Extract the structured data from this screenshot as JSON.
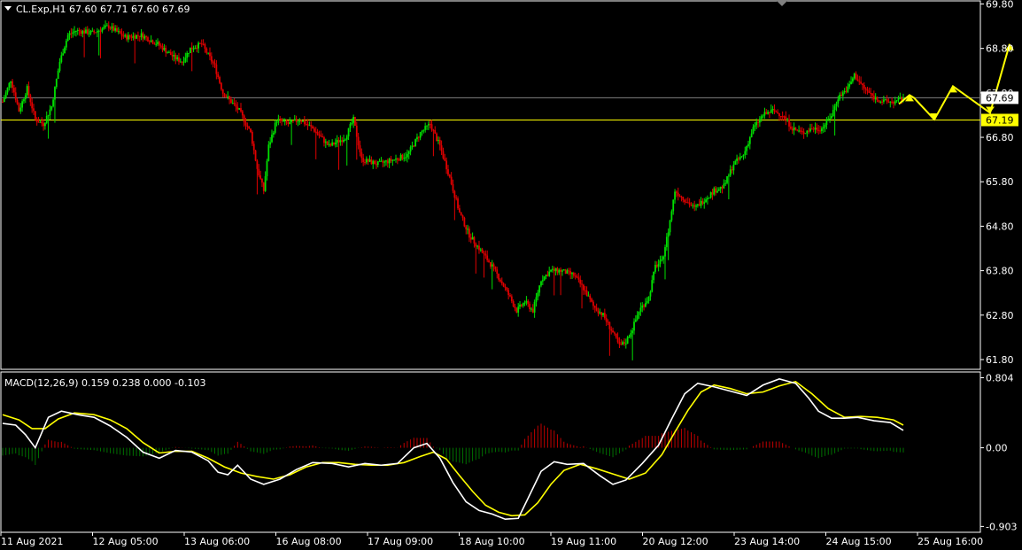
{
  "header": {
    "symbol_line": "CL.Exp,H1  67.60 67.71 67.60 67.69"
  },
  "macd_header": "MACD(12,26,9) 0.159 0.238 0.000 -0.103",
  "colors": {
    "background": "#000000",
    "bull_candle": "#00e000",
    "bear_candle": "#e00000",
    "macd_line": "#ffffff",
    "signal_line": "#ffff00",
    "hist_pos": "#c00000",
    "hist_neg": "#007000",
    "price_line": "#808080",
    "level_line": "#ffff00",
    "arrow": "#ffff00"
  },
  "chart_data": [
    {
      "type": "candlestick",
      "title": "CL.Exp,H1",
      "ohlc_last": {
        "open": 67.6,
        "high": 67.71,
        "low": 67.6,
        "close": 67.69
      },
      "y_ticks": [
        "69.80",
        "68.80",
        "67.80",
        "66.80",
        "65.80",
        "64.80",
        "63.80",
        "62.80",
        "61.80"
      ],
      "ylim": [
        61.6,
        69.85
      ],
      "x_ticks": [
        "11 Aug 2021",
        "12 Aug 05:00",
        "13 Aug 06:00",
        "16 Aug 08:00",
        "17 Aug 09:00",
        "18 Aug 10:00",
        "19 Aug 11:00",
        "20 Aug 12:00",
        "23 Aug 14:00",
        "24 Aug 15:00",
        "25 Aug 16:00"
      ],
      "current_price_label": "67.69",
      "level_label": "67.19",
      "current_price": 67.69,
      "level_price": 67.19,
      "path": [
        [
          0,
          67.6
        ],
        [
          5,
          68.1
        ],
        [
          10,
          67.4
        ],
        [
          15,
          67.9
        ],
        [
          20,
          67.2
        ],
        [
          25,
          67.1
        ],
        [
          30,
          67.5
        ],
        [
          35,
          68.5
        ],
        [
          40,
          69.1
        ],
        [
          45,
          69.2
        ],
        [
          55,
          69.15
        ],
        [
          65,
          69.3
        ],
        [
          75,
          69.05
        ],
        [
          85,
          69.1
        ],
        [
          95,
          68.9
        ],
        [
          105,
          68.6
        ],
        [
          110,
          68.5
        ],
        [
          115,
          68.8
        ],
        [
          122,
          68.9
        ],
        [
          130,
          68.4
        ],
        [
          135,
          67.8
        ],
        [
          140,
          67.6
        ],
        [
          145,
          67.4
        ],
        [
          152,
          66.9
        ],
        [
          156,
          66.1
        ],
        [
          160,
          65.6
        ],
        [
          163,
          66.6
        ],
        [
          168,
          67.2
        ],
        [
          175,
          67.1
        ],
        [
          182,
          67.2
        ],
        [
          190,
          67.0
        ],
        [
          200,
          66.6
        ],
        [
          210,
          66.8
        ],
        [
          215,
          67.2
        ],
        [
          220,
          66.3
        ],
        [
          230,
          66.2
        ],
        [
          240,
          66.3
        ],
        [
          248,
          66.4
        ],
        [
          256,
          66.9
        ],
        [
          262,
          67.1
        ],
        [
          268,
          66.6
        ],
        [
          274,
          65.9
        ],
        [
          280,
          65.1
        ],
        [
          286,
          64.6
        ],
        [
          292,
          64.3
        ],
        [
          300,
          63.9
        ],
        [
          308,
          63.4
        ],
        [
          315,
          62.9
        ],
        [
          320,
          63.1
        ],
        [
          325,
          62.9
        ],
        [
          330,
          63.6
        ],
        [
          336,
          63.8
        ],
        [
          342,
          63.8
        ],
        [
          350,
          63.7
        ],
        [
          356,
          63.4
        ],
        [
          362,
          63.0
        ],
        [
          368,
          62.8
        ],
        [
          374,
          62.4
        ],
        [
          378,
          62.1
        ],
        [
          382,
          62.2
        ],
        [
          386,
          62.5
        ],
        [
          390,
          62.9
        ],
        [
          396,
          63.2
        ],
        [
          400,
          63.9
        ],
        [
          404,
          64.0
        ],
        [
          408,
          64.7
        ],
        [
          412,
          65.6
        ],
        [
          418,
          65.4
        ],
        [
          424,
          65.2
        ],
        [
          430,
          65.4
        ],
        [
          436,
          65.6
        ],
        [
          442,
          65.7
        ],
        [
          448,
          66.2
        ],
        [
          454,
          66.4
        ],
        [
          460,
          67.0
        ],
        [
          466,
          67.3
        ],
        [
          472,
          67.4
        ],
        [
          478,
          67.3
        ],
        [
          484,
          67.0
        ],
        [
          490,
          66.9
        ],
        [
          496,
          67.0
        ],
        [
          502,
          67.0
        ],
        [
          508,
          67.3
        ],
        [
          512,
          67.7
        ],
        [
          518,
          67.9
        ],
        [
          522,
          68.2
        ],
        [
          528,
          67.9
        ],
        [
          534,
          67.7
        ],
        [
          540,
          67.6
        ],
        [
          548,
          67.6
        ],
        [
          552,
          67.69
        ]
      ],
      "forecast_arrow": [
        [
          67.55,
          66.1
        ],
        [
          67.75,
          66.75
        ],
        [
          67.25,
          67.4
        ],
        [
          67.95,
          68.6
        ],
        [
          67.35,
          69.7
        ],
        [
          68.9,
          69.85
        ]
      ]
    },
    {
      "type": "macd",
      "title": "MACD(12,26,9)",
      "values": {
        "macd": 0.159,
        "signal": 0.238,
        "hist": 0.0,
        "osma": -0.103
      },
      "y_ticks": [
        "0.804",
        "0.00",
        "-0.903"
      ],
      "ylim": [
        -0.96,
        0.86
      ],
      "macd_line": [
        [
          0,
          0.28
        ],
        [
          8,
          0.26
        ],
        [
          14,
          0.15
        ],
        [
          20,
          0.0
        ],
        [
          28,
          0.35
        ],
        [
          36,
          0.42
        ],
        [
          46,
          0.38
        ],
        [
          56,
          0.35
        ],
        [
          66,
          0.25
        ],
        [
          76,
          0.12
        ],
        [
          86,
          -0.05
        ],
        [
          96,
          -0.12
        ],
        [
          106,
          -0.03
        ],
        [
          116,
          -0.05
        ],
        [
          126,
          -0.15
        ],
        [
          132,
          -0.28
        ],
        [
          138,
          -0.31
        ],
        [
          144,
          -0.2
        ],
        [
          152,
          -0.36
        ],
        [
          160,
          -0.42
        ],
        [
          170,
          -0.36
        ],
        [
          180,
          -0.25
        ],
        [
          190,
          -0.17
        ],
        [
          202,
          -0.18
        ],
        [
          212,
          -0.22
        ],
        [
          222,
          -0.18
        ],
        [
          232,
          -0.2
        ],
        [
          242,
          -0.18
        ],
        [
          252,
          0.0
        ],
        [
          260,
          0.05
        ],
        [
          268,
          -0.12
        ],
        [
          276,
          -0.4
        ],
        [
          284,
          -0.62
        ],
        [
          292,
          -0.72
        ],
        [
          300,
          -0.76
        ],
        [
          308,
          -0.82
        ],
        [
          316,
          -0.81
        ],
        [
          322,
          -0.58
        ],
        [
          330,
          -0.27
        ],
        [
          338,
          -0.16
        ],
        [
          346,
          -0.19
        ],
        [
          356,
          -0.18
        ],
        [
          366,
          -0.32
        ],
        [
          374,
          -0.42
        ],
        [
          382,
          -0.37
        ],
        [
          392,
          -0.18
        ],
        [
          402,
          0.03
        ],
        [
          410,
          0.33
        ],
        [
          418,
          0.62
        ],
        [
          426,
          0.74
        ],
        [
          436,
          0.7
        ],
        [
          446,
          0.65
        ],
        [
          456,
          0.6
        ],
        [
          466,
          0.72
        ],
        [
          476,
          0.79
        ],
        [
          486,
          0.74
        ],
        [
          494,
          0.57
        ],
        [
          500,
          0.42
        ],
        [
          508,
          0.34
        ],
        [
          516,
          0.34
        ],
        [
          524,
          0.35
        ],
        [
          534,
          0.31
        ],
        [
          544,
          0.29
        ],
        [
          552,
          0.2
        ]
      ],
      "signal_line": [
        [
          0,
          0.38
        ],
        [
          10,
          0.32
        ],
        [
          18,
          0.22
        ],
        [
          26,
          0.22
        ],
        [
          34,
          0.33
        ],
        [
          44,
          0.4
        ],
        [
          56,
          0.38
        ],
        [
          66,
          0.32
        ],
        [
          76,
          0.22
        ],
        [
          86,
          0.06
        ],
        [
          96,
          -0.06
        ],
        [
          106,
          -0.04
        ],
        [
          116,
          -0.04
        ],
        [
          126,
          -0.12
        ],
        [
          136,
          -0.22
        ],
        [
          146,
          -0.29
        ],
        [
          156,
          -0.33
        ],
        [
          166,
          -0.36
        ],
        [
          176,
          -0.31
        ],
        [
          186,
          -0.22
        ],
        [
          196,
          -0.17
        ],
        [
          206,
          -0.17
        ],
        [
          216,
          -0.19
        ],
        [
          226,
          -0.2
        ],
        [
          236,
          -0.2
        ],
        [
          246,
          -0.17
        ],
        [
          256,
          -0.1
        ],
        [
          264,
          -0.05
        ],
        [
          272,
          -0.13
        ],
        [
          280,
          -0.32
        ],
        [
          288,
          -0.5
        ],
        [
          296,
          -0.66
        ],
        [
          304,
          -0.74
        ],
        [
          312,
          -0.78
        ],
        [
          320,
          -0.77
        ],
        [
          328,
          -0.63
        ],
        [
          336,
          -0.42
        ],
        [
          344,
          -0.26
        ],
        [
          354,
          -0.19
        ],
        [
          364,
          -0.24
        ],
        [
          374,
          -0.3
        ],
        [
          384,
          -0.36
        ],
        [
          394,
          -0.29
        ],
        [
          404,
          -0.08
        ],
        [
          412,
          0.18
        ],
        [
          420,
          0.43
        ],
        [
          428,
          0.64
        ],
        [
          436,
          0.72
        ],
        [
          446,
          0.68
        ],
        [
          456,
          0.62
        ],
        [
          466,
          0.64
        ],
        [
          476,
          0.71
        ],
        [
          486,
          0.76
        ],
        [
          496,
          0.62
        ],
        [
          506,
          0.45
        ],
        [
          516,
          0.35
        ],
        [
          526,
          0.36
        ],
        [
          536,
          0.35
        ],
        [
          546,
          0.32
        ],
        [
          552,
          0.26
        ]
      ]
    }
  ]
}
